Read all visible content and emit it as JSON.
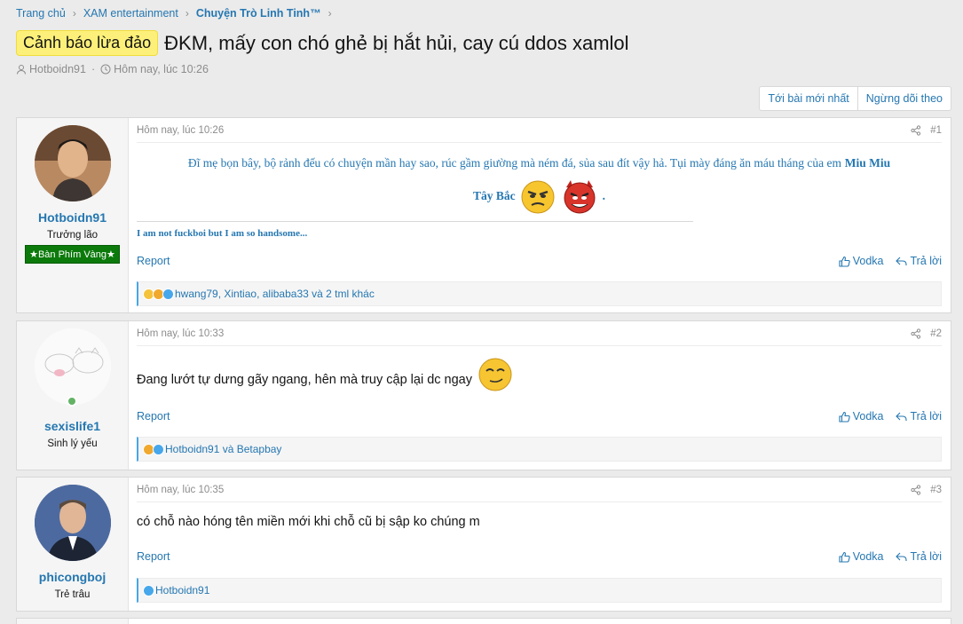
{
  "breadcrumb": [
    "Trang chủ",
    "XAM entertainment",
    "Chuyện Trò Linh Tinh™"
  ],
  "thread": {
    "prefix": "Cảnh báo lừa đảo",
    "title": "ĐKM, mấy con chó ghẻ bị hắt hủi, cay cú ddos xamlol",
    "author": "Hotboidn91",
    "date": "Hôm nay, lúc 10:26"
  },
  "buttons": {
    "latest": "Tới bài mới nhất",
    "unwatch": "Ngừng dõi theo"
  },
  "actions": {
    "report": "Report",
    "like": "Vodka",
    "reply": "Trả lời"
  },
  "posts": [
    {
      "username": "Hotboidn91",
      "user_title": "Trưởng lão",
      "banner": "★Bàn Phím Vàng★",
      "time": "Hôm nay, lúc 10:26",
      "number": "#1",
      "body_line1": "Đĩ mẹ bọn bây, bộ rảnh đếu có chuyện mần hay sao, rúc gầm giường mà ném đá, sủa sau đít vậy hả. Tụi mày đáng ăn máu tháng của em",
      "body_bold": "Miu Miu",
      "body_line2": "Tây Bắc",
      "body_end": ".",
      "signature": "I am not fuckboi but I am so handsome...",
      "reactions": "hwang79, Xintiao, alibaba33 và 2 tml khác"
    },
    {
      "username": "sexislife1",
      "user_title": "Sinh lý yếu",
      "time": "Hôm nay, lúc 10:33",
      "number": "#2",
      "body": "Đang lướt tự dưng gãy ngang, hên mà truy cập lại dc ngay",
      "reactions": "Hotboidn91 và Betapbay"
    },
    {
      "username": "phicongboj",
      "user_title": "Trẻ trâu",
      "time": "Hôm nay, lúc 10:35",
      "number": "#3",
      "body": "có chỗ nào hóng tên miền mới khi chỗ cũ bị sập ko chúng m",
      "reactions": "Hotboidn91"
    }
  ],
  "colors": {
    "link": "#2577b1",
    "badge_bg": "#fdf07a",
    "banner_green": "#0b7a0b",
    "online": "#63b265"
  }
}
